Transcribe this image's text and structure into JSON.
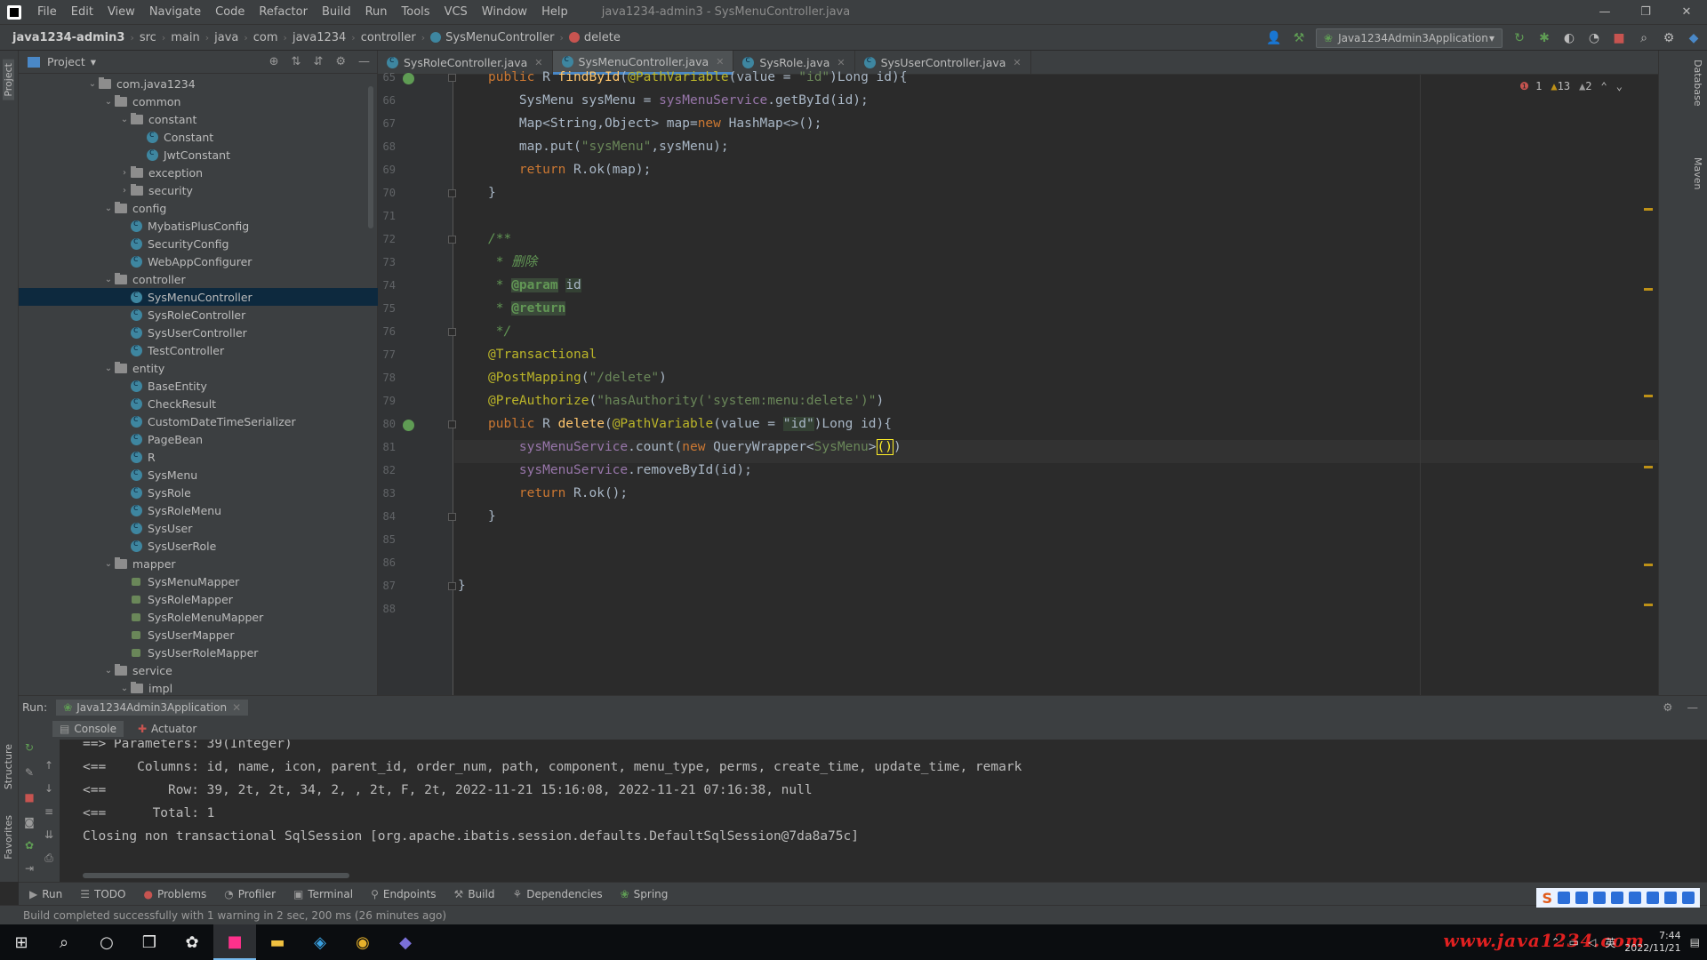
{
  "menu": {
    "items": [
      "File",
      "Edit",
      "View",
      "Navigate",
      "Code",
      "Refactor",
      "Build",
      "Run",
      "Tools",
      "VCS",
      "Window",
      "Help"
    ],
    "window_title": "java1234-admin3 - SysMenuController.java"
  },
  "breadcrumb": [
    "java1234-admin3",
    "src",
    "main",
    "java",
    "com",
    "java1234",
    "controller",
    "SysMenuController",
    "delete"
  ],
  "run_config": "Java1234Admin3Application",
  "project": {
    "title": "Project",
    "tree": [
      {
        "label": "com.java1234",
        "type": "folder",
        "depth": 0,
        "open": true
      },
      {
        "label": "common",
        "type": "folder",
        "depth": 1,
        "open": true
      },
      {
        "label": "constant",
        "type": "folder",
        "depth": 2,
        "open": true
      },
      {
        "label": "Constant",
        "type": "class",
        "depth": 3
      },
      {
        "label": "JwtConstant",
        "type": "class",
        "depth": 3
      },
      {
        "label": "exception",
        "type": "folder",
        "depth": 2,
        "open": false
      },
      {
        "label": "security",
        "type": "folder",
        "depth": 2,
        "open": false
      },
      {
        "label": "config",
        "type": "folder",
        "depth": 1,
        "open": true
      },
      {
        "label": "MybatisPlusConfig",
        "type": "class",
        "depth": 2
      },
      {
        "label": "SecurityConfig",
        "type": "class",
        "depth": 2
      },
      {
        "label": "WebAppConfigurer",
        "type": "class",
        "depth": 2
      },
      {
        "label": "controller",
        "type": "folder",
        "depth": 1,
        "open": true
      },
      {
        "label": "SysMenuController",
        "type": "class",
        "depth": 2,
        "selected": true
      },
      {
        "label": "SysRoleController",
        "type": "class",
        "depth": 2
      },
      {
        "label": "SysUserController",
        "type": "class",
        "depth": 2
      },
      {
        "label": "TestController",
        "type": "class",
        "depth": 2
      },
      {
        "label": "entity",
        "type": "folder",
        "depth": 1,
        "open": true
      },
      {
        "label": "BaseEntity",
        "type": "class",
        "depth": 2
      },
      {
        "label": "CheckResult",
        "type": "class",
        "depth": 2
      },
      {
        "label": "CustomDateTimeSerializer",
        "type": "class",
        "depth": 2
      },
      {
        "label": "PageBean",
        "type": "class",
        "depth": 2
      },
      {
        "label": "R",
        "type": "class",
        "depth": 2
      },
      {
        "label": "SysMenu",
        "type": "class",
        "depth": 2
      },
      {
        "label": "SysRole",
        "type": "class",
        "depth": 2
      },
      {
        "label": "SysRoleMenu",
        "type": "class",
        "depth": 2
      },
      {
        "label": "SysUser",
        "type": "class",
        "depth": 2
      },
      {
        "label": "SysUserRole",
        "type": "class",
        "depth": 2
      },
      {
        "label": "mapper",
        "type": "folder",
        "depth": 1,
        "open": true
      },
      {
        "label": "SysMenuMapper",
        "type": "mapper",
        "depth": 2
      },
      {
        "label": "SysRoleMapper",
        "type": "mapper",
        "depth": 2
      },
      {
        "label": "SysRoleMenuMapper",
        "type": "mapper",
        "depth": 2
      },
      {
        "label": "SysUserMapper",
        "type": "mapper",
        "depth": 2
      },
      {
        "label": "SysUserRoleMapper",
        "type": "mapper",
        "depth": 2
      },
      {
        "label": "service",
        "type": "folder",
        "depth": 1,
        "open": true
      },
      {
        "label": "impl",
        "type": "folder",
        "depth": 2,
        "open": true
      }
    ]
  },
  "editor_tabs": [
    {
      "label": "SysRoleController.java",
      "active": false
    },
    {
      "label": "SysMenuController.java",
      "active": true
    },
    {
      "label": "SysRole.java",
      "active": false
    },
    {
      "label": "SysUserController.java",
      "active": false
    }
  ],
  "inspections": {
    "errors": "1",
    "warnings": "13",
    "weak": "2"
  },
  "line_numbers": [
    "65",
    "66",
    "67",
    "68",
    "69",
    "70",
    "71",
    "72",
    "73",
    "74",
    "75",
    "76",
    "77",
    "78",
    "79",
    "80",
    "81",
    "82",
    "83",
    "84",
    "85",
    "86",
    "87",
    "88"
  ],
  "code": [
    [
      [
        "kw",
        "public "
      ],
      [
        "",
        "R "
      ],
      [
        "fn",
        "findById"
      ],
      [
        "",
        "("
      ],
      [
        "ann",
        "@PathVariable"
      ],
      [
        "",
        "(value = "
      ],
      [
        "str",
        "\"id\""
      ],
      [
        "",
        ")Long id){"
      ]
    ],
    [
      [
        "",
        "    SysMenu sysMenu = "
      ],
      [
        "fld",
        "sysMenuService"
      ],
      [
        "",
        ".getById(id);"
      ]
    ],
    [
      [
        "",
        "    Map<String,Object> map="
      ],
      [
        "kw",
        "new "
      ],
      [
        "",
        "HashMap<>();"
      ]
    ],
    [
      [
        "",
        "    map.put("
      ],
      [
        "str",
        "\"sysMenu\""
      ],
      [
        "",
        ",sysMenu);"
      ]
    ],
    [
      [
        "kw",
        "    return "
      ],
      [
        "",
        "R."
      ],
      [
        "",
        "ok(map);"
      ]
    ],
    [
      [
        "",
        "}"
      ]
    ],
    [
      [
        "",
        ""
      ]
    ],
    [
      [
        "cmt",
        "/**"
      ]
    ],
    [
      [
        "cmt",
        " * 删除"
      ]
    ],
    [
      [
        "cmt",
        " * "
      ],
      [
        "tag",
        "@param"
      ],
      [
        "cmt",
        " "
      ],
      [
        "hl",
        "id"
      ]
    ],
    [
      [
        "cmt",
        " * "
      ],
      [
        "tag",
        "@return"
      ]
    ],
    [
      [
        "cmt",
        " */"
      ]
    ],
    [
      [
        "ann",
        "@Transactional"
      ]
    ],
    [
      [
        "ann",
        "@PostMapping"
      ],
      [
        "",
        "("
      ],
      [
        "str",
        "\"/delete\""
      ],
      [
        "",
        ")"
      ]
    ],
    [
      [
        "ann",
        "@PreAuthorize"
      ],
      [
        "",
        "("
      ],
      [
        "str",
        "\"hasAuthority('system:menu:delete')\""
      ],
      [
        "",
        ")"
      ]
    ],
    [
      [
        "kw",
        "public "
      ],
      [
        "",
        "R "
      ],
      [
        "fn",
        "delete"
      ],
      [
        "",
        "("
      ],
      [
        "ann",
        "@PathVariable"
      ],
      [
        "",
        "(value = "
      ],
      [
        "hl",
        "\"id\""
      ],
      [
        "",
        ")Long id){"
      ]
    ],
    [
      [
        "fld",
        "    sysMenuService"
      ],
      [
        "",
        ".count("
      ],
      [
        "kw",
        "new "
      ],
      [
        "",
        "QueryWrapper<"
      ],
      [
        "str",
        "SysMenu"
      ],
      [
        "",
        ">"
      ],
      [
        "caret",
        "()"
      ],
      [
        "",
        ")"
      ]
    ],
    [
      [
        "fld",
        "    sysMenuService"
      ],
      [
        "",
        ".removeById(id);"
      ]
    ],
    [
      [
        "kw",
        "    return "
      ],
      [
        "",
        "R.ok();"
      ]
    ],
    [
      [
        "",
        "}"
      ]
    ],
    [
      [
        "",
        ""
      ]
    ],
    [
      [
        "",
        ""
      ]
    ],
    [
      [
        "",
        "}"
      ]
    ],
    [
      [
        "",
        ""
      ]
    ]
  ],
  "run": {
    "label": "Run:",
    "config": "Java1234Admin3Application",
    "tabs": [
      "Console",
      "Actuator"
    ]
  },
  "console": [
    "==> Parameters: 39(Integer)",
    "<==    Columns: id, name, icon, parent_id, order_num, path, component, menu_type, perms, create_time, update_time, remark",
    "<==        Row: 39, 2t, 2t, 34, 2, , 2t, F, 2t, 2022-11-21 15:16:08, 2022-11-21 07:16:38, null",
    "<==      Total: 1",
    "Closing non transactional SqlSession [org.apache.ibatis.session.defaults.DefaultSqlSession@7da8a75c]"
  ],
  "tool_tabs": [
    "Run",
    "TODO",
    "Problems",
    "Profiler",
    "Terminal",
    "Endpoints",
    "Build",
    "Dependencies",
    "Spring"
  ],
  "status": "Build completed successfully with 1 warning in 2 sec, 200 ms (26 minutes ago)",
  "watermark": "www.java1234.com",
  "clock": {
    "time": "7:44",
    "date": "2022/11/21"
  },
  "tray_lang": "英",
  "side_tabs": {
    "left": [
      "Project",
      "Structure",
      "Favorites"
    ],
    "right": [
      "Database",
      "Maven"
    ]
  },
  "colors": {
    "accent": "#4a88c7",
    "keyword": "#cc7832",
    "string": "#6a8759",
    "annotation": "#bbb529",
    "field": "#9876aa",
    "method": "#ffc66d",
    "selection": "#0d293e"
  }
}
